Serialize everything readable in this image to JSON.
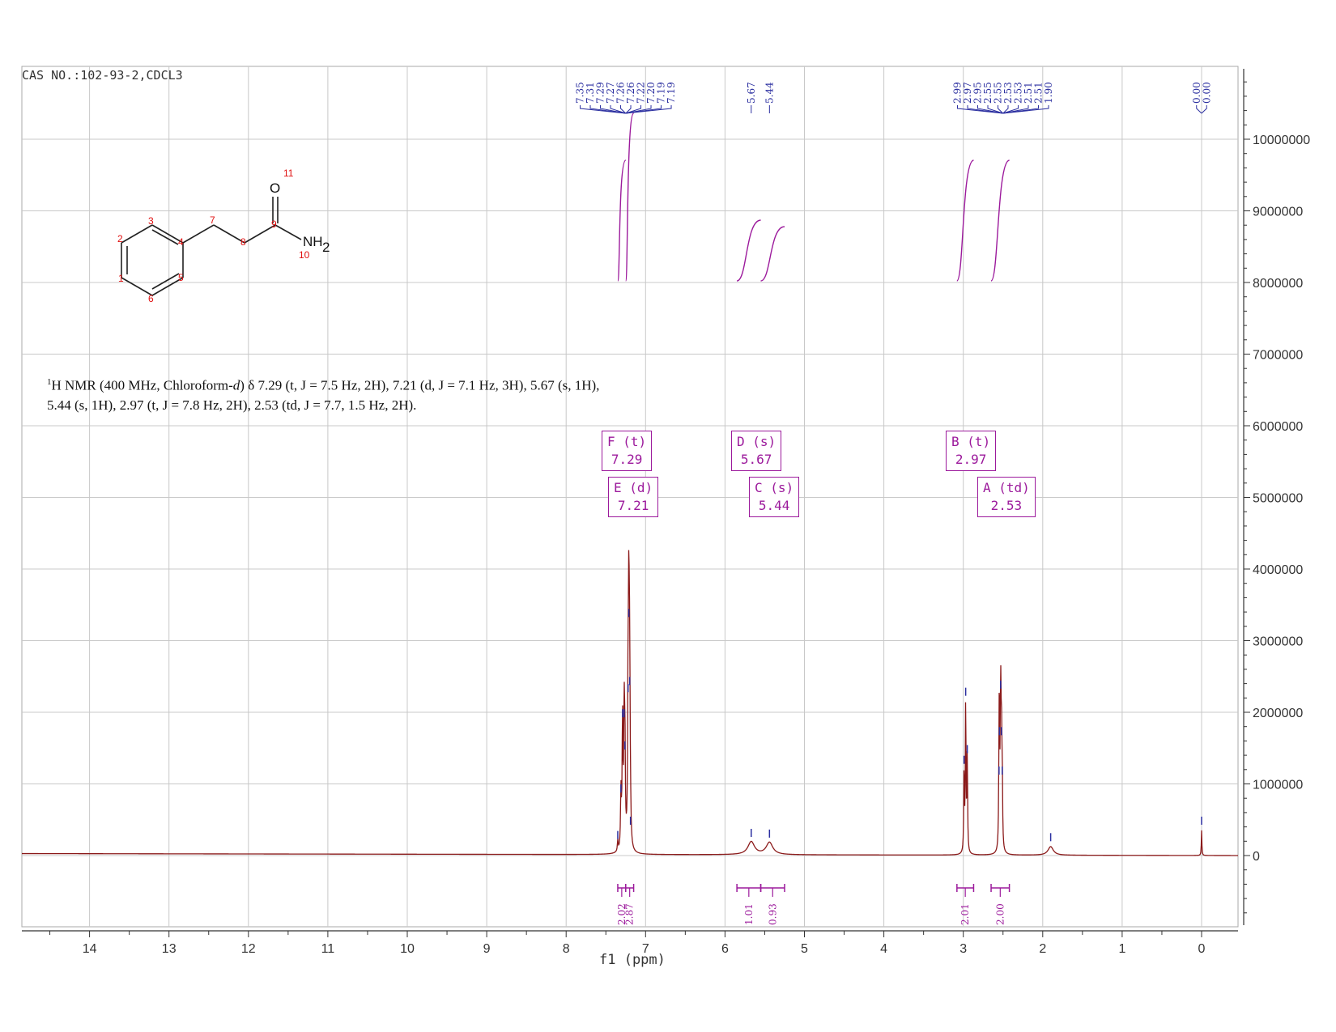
{
  "sample_label": "CAS NO.:102-93-2,CDCL3",
  "description": {
    "line1_pre": "H NMR (400 MHz, Chloroform-",
    "line1_sup": "1",
    "line1_solvent_italic": "d",
    "line1_post": ") δ 7.29 (t, J = 7.5 Hz, 2H), 7.21 (d, J = 7.1 Hz, 3H), 5.67 (s, 1H),",
    "line2": "5.44 (s, 1H), 2.97 (t, J = 7.8 Hz, 2H), 2.53 (td, J = 7.7, 1.5 Hz, 2H)."
  },
  "molecule": {
    "atom_numbers": [
      "1",
      "2",
      "3",
      "4",
      "5",
      "6",
      "7",
      "8",
      "9",
      "10",
      "11"
    ],
    "oxygen": "O",
    "amine": "NH",
    "amine_sub": "2"
  },
  "multiplets": [
    {
      "label": "F (t)",
      "shift": "7.29"
    },
    {
      "label": "E (d)",
      "shift": "7.21"
    },
    {
      "label": "D (s)",
      "shift": "5.67"
    },
    {
      "label": "C (s)",
      "shift": "5.44"
    },
    {
      "label": "B (t)",
      "shift": "2.97"
    },
    {
      "label": "A (td)",
      "shift": "2.53"
    }
  ],
  "chart_data": {
    "type": "line",
    "title": "",
    "xlabel": "f1 (ppm)",
    "ylabel": "",
    "xlim": [
      14.8,
      -0.47
    ],
    "ylim": [
      -1000000,
      11000000
    ],
    "x_reversed": true,
    "grid": true,
    "x_ticks": [
      14,
      13,
      12,
      11,
      10,
      9,
      8,
      7,
      6,
      5,
      4,
      3,
      2,
      1,
      0
    ],
    "y_ticks": [
      0,
      1000000,
      2000000,
      3000000,
      4000000,
      5000000,
      6000000,
      7000000,
      8000000,
      9000000,
      10000000
    ],
    "y_tick_labels": [
      "0",
      "1000000",
      "2000000",
      "3000000",
      "4000000",
      "5000000",
      "6000000",
      "7000000",
      "8000000",
      "9000000",
      "10000000"
    ],
    "peaks": [
      {
        "ppm": 7.35,
        "height": 150000,
        "width": 0.006
      },
      {
        "ppm": 7.31,
        "height": 800000,
        "width": 0.006
      },
      {
        "ppm": 7.29,
        "height": 1850000,
        "width": 0.006
      },
      {
        "ppm": 7.27,
        "height": 1850000,
        "width": 0.006
      },
      {
        "ppm": 7.26,
        "height": 1400000,
        "width": 0.006
      },
      {
        "ppm": 7.22,
        "height": 2200000,
        "width": 0.006
      },
      {
        "ppm": 7.21,
        "height": 3250000,
        "width": 0.006
      },
      {
        "ppm": 7.2,
        "height": 2300000,
        "width": 0.006
      },
      {
        "ppm": 7.19,
        "height": 350000,
        "width": 0.006
      },
      {
        "ppm": 5.67,
        "height": 180000,
        "width": 0.05
      },
      {
        "ppm": 5.44,
        "height": 170000,
        "width": 0.05
      },
      {
        "ppm": 2.99,
        "height": 1200000,
        "width": 0.005
      },
      {
        "ppm": 2.97,
        "height": 2150000,
        "width": 0.005
      },
      {
        "ppm": 2.95,
        "height": 1350000,
        "width": 0.005
      },
      {
        "ppm": 2.55,
        "height": 1050000,
        "width": 0.005
      },
      {
        "ppm": 2.545,
        "height": 1600000,
        "width": 0.005
      },
      {
        "ppm": 2.53,
        "height": 2250000,
        "width": 0.005
      },
      {
        "ppm": 2.52,
        "height": 1600000,
        "width": 0.005
      },
      {
        "ppm": 2.51,
        "height": 1050000,
        "width": 0.005
      },
      {
        "ppm": 1.9,
        "height": 120000,
        "width": 0.04
      },
      {
        "ppm": 0.0,
        "height": 350000,
        "width": 0.004
      }
    ],
    "peak_labels": [
      {
        "group": "aromatic",
        "labels": [
          "7.35",
          "7.31",
          "7.29",
          "7.27",
          "7.26",
          "7.26",
          "7.22",
          "7.20",
          "7.19",
          "7.19"
        ],
        "anchor_ppm": 7.25
      },
      {
        "group": "nh1",
        "labels": [
          "5.67"
        ],
        "anchor_ppm": 5.67
      },
      {
        "group": "nh2",
        "labels": [
          "5.44"
        ],
        "anchor_ppm": 5.44
      },
      {
        "group": "ch2",
        "labels": [
          "2.99",
          "2.97",
          "2.95",
          "2.55",
          "2.55",
          "2.53",
          "2.53",
          "2.51",
          "2.51",
          "1.90"
        ],
        "anchor_ppm": 2.5
      },
      {
        "group": "tms",
        "labels": [
          "0.00",
          "0.00"
        ],
        "anchor_ppm": 0.0
      }
    ],
    "integrations": [
      {
        "from": 7.35,
        "to": 7.25,
        "value": "2.02"
      },
      {
        "from": 7.25,
        "to": 7.15,
        "value": "2.87"
      },
      {
        "from": 5.85,
        "to": 5.55,
        "value": "1.01"
      },
      {
        "from": 5.55,
        "to": 5.25,
        "value": "0.93"
      },
      {
        "from": 3.08,
        "to": 2.87,
        "value": "2.01"
      },
      {
        "from": 2.65,
        "to": 2.42,
        "value": "2.00"
      }
    ],
    "colors": {
      "spectrum": "#8b1a1a",
      "integral": "#9c1a9c",
      "peak_label": "#2b2fa0",
      "grid": "#c8c8c8"
    }
  }
}
